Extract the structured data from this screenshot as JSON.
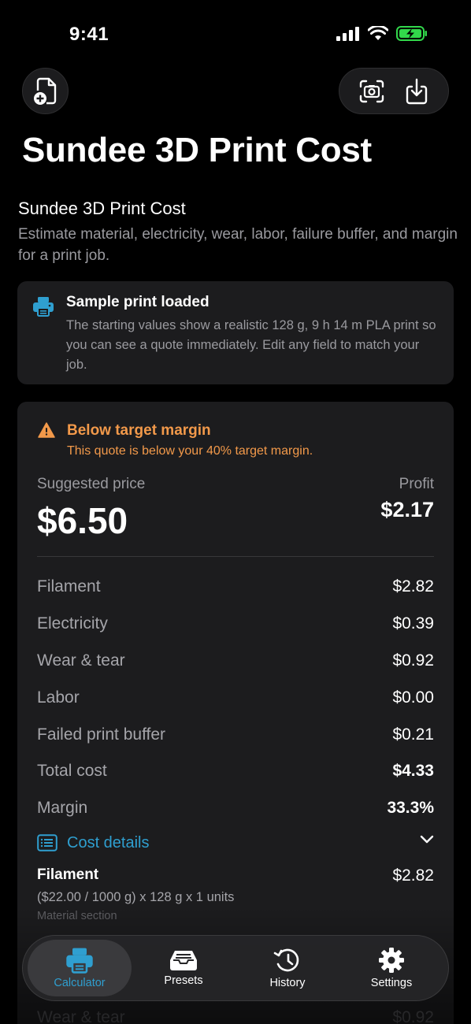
{
  "status_bar": {
    "time": "9:41"
  },
  "header": {
    "title": "Sundee 3D Print Cost"
  },
  "intro": {
    "title": "Sundee 3D Print Cost",
    "description": "Estimate material, electricity, wear, labor, failure buffer, and margin for a print job."
  },
  "sample_card": {
    "icon": "printer-icon",
    "title": "Sample print loaded",
    "text": "The starting values show a realistic 128 g, 9 h 14 m PLA print so you can see a quote immediately. Edit any field to match your job."
  },
  "quote": {
    "warning_title": "Below target margin",
    "warning_text": "This quote is below your 40% target margin.",
    "suggested_price_label": "Suggested price",
    "suggested_price": "$6.50",
    "profit_label": "Profit",
    "profit": "$2.17",
    "rows": [
      {
        "label": "Filament",
        "value": "$2.82"
      },
      {
        "label": "Electricity",
        "value": "$0.39"
      },
      {
        "label": "Wear & tear",
        "value": "$0.92"
      },
      {
        "label": "Labor",
        "value": "$0.00"
      },
      {
        "label": "Failed print buffer",
        "value": "$0.21"
      },
      {
        "label": "Total cost",
        "value": "$4.33"
      },
      {
        "label": "Margin",
        "value": "33.3%"
      }
    ],
    "details_label": "Cost details",
    "details": [
      {
        "title": "Filament",
        "amount": "$2.82",
        "formula": "($22.00 / 1000 g) x 128 g x 1 units",
        "section": "Material section"
      }
    ],
    "faded_rows": [
      {
        "label": "Wear & tear",
        "value": "$0.92"
      }
    ]
  },
  "tabs": [
    {
      "label": "Calculator",
      "icon": "printer-icon",
      "active": true
    },
    {
      "label": "Presets",
      "icon": "tray-icon",
      "active": false
    },
    {
      "label": "History",
      "icon": "history-icon",
      "active": false
    },
    {
      "label": "Settings",
      "icon": "gear-icon",
      "active": false
    }
  ],
  "colors": {
    "accent": "#2f9fd0",
    "warning": "#f2994a",
    "battery": "#32d74b"
  }
}
